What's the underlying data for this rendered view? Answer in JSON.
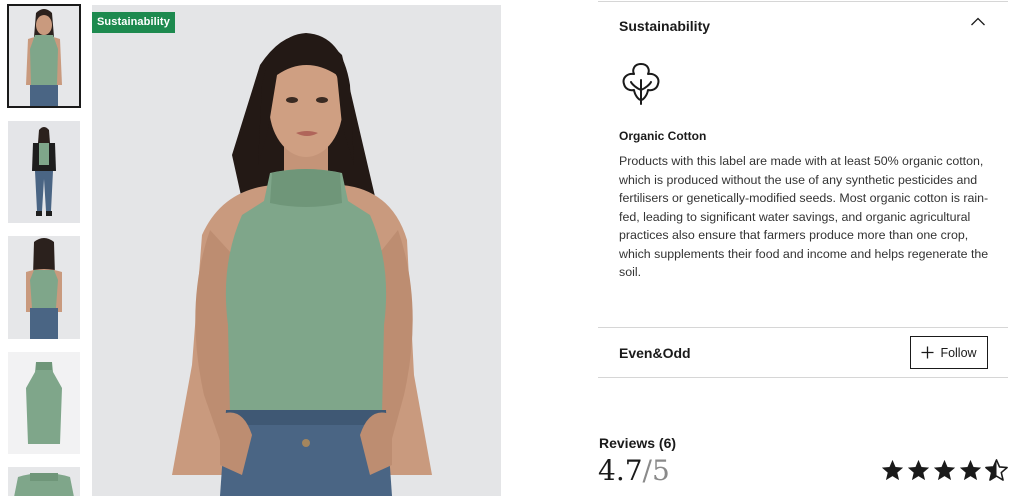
{
  "gallery": {
    "thumbnails": [
      {
        "view": "front-close",
        "selected": true
      },
      {
        "view": "full-body-jacket",
        "selected": false
      },
      {
        "view": "back",
        "selected": false
      },
      {
        "view": "product-flat",
        "selected": false
      },
      {
        "view": "detail",
        "selected": false
      }
    ],
    "badge": "Sustainability",
    "colors": {
      "garment": "#7fa68a",
      "badge": "#1d8a4f",
      "denim": "#4a6584"
    }
  },
  "sustainability": {
    "title": "Sustainability",
    "icon": "cotton-flower-icon",
    "label_title": "Organic Cotton",
    "description": "Products with this label are made with at least 50% organic cotton, which is produced without the use of any synthetic pesticides and fertilisers or genetically-modified seeds. Most organic cotton is rain-fed, leading to significant water savings, and organic agricultural practices also ensure that farmers produce more than one crop, which supplements their food and income and helps regenerate the soil."
  },
  "brand": {
    "name": "Even&Odd",
    "follow_label": "Follow"
  },
  "reviews": {
    "label": "Reviews (6)",
    "rating": "4.7",
    "max": "/5",
    "stars_value": 4.7
  }
}
